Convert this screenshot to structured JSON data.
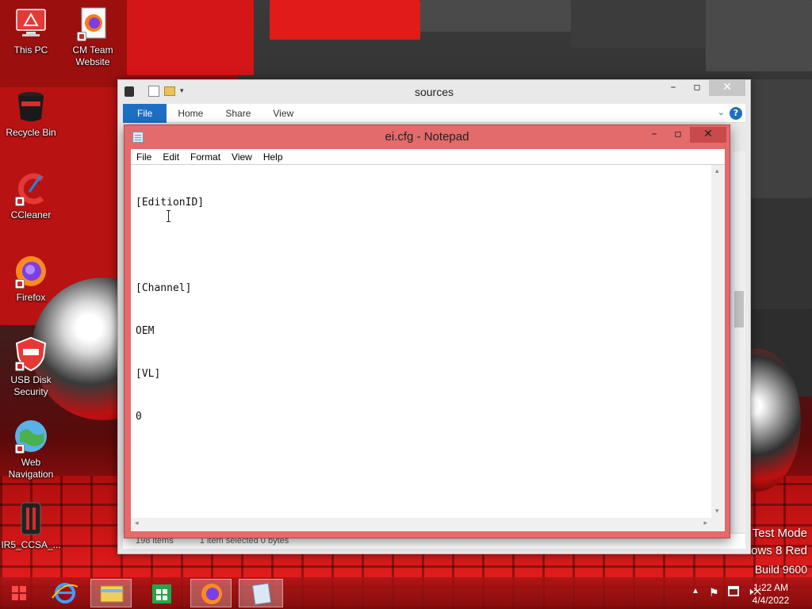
{
  "desktop": {
    "icons": [
      {
        "label": "This PC",
        "icon": "this-pc-icon"
      },
      {
        "label": "CM Team\nWebsite",
        "icon": "firefox-shortcut-icon"
      },
      {
        "label": "Recycle Bin",
        "icon": "recycle-bin-icon"
      },
      {
        "label": "CCleaner",
        "icon": "ccleaner-icon"
      },
      {
        "label": "Firefox",
        "icon": "firefox-icon"
      },
      {
        "label": "USB Disk\nSecurity",
        "icon": "usb-disk-security-icon"
      },
      {
        "label": "Web\nNavigation",
        "icon": "web-navigation-icon"
      },
      {
        "label": "IR5_CCSA_...",
        "icon": "ir5-ccsa-icon"
      }
    ],
    "watermark": {
      "line1": "Test Mode",
      "line2": "lows 8 Red",
      "line3": "Build 9600"
    }
  },
  "explorer": {
    "title": "sources",
    "ribbon_tabs": [
      "File",
      "Home",
      "Share",
      "View"
    ],
    "status": {
      "items": "198 items",
      "selected": "1 item selected  0 bytes"
    },
    "help_glyph": "?"
  },
  "notepad": {
    "title": "ei.cfg - Notepad",
    "menus": [
      "File",
      "Edit",
      "Format",
      "View",
      "Help"
    ],
    "lines": [
      "[EditionID]",
      "",
      "[Channel]",
      "OEM",
      "[VL]",
      "0"
    ]
  },
  "taskbar": {
    "apps": [
      "internet-explorer-icon",
      "file-explorer-icon",
      "store-icon",
      "firefox-icon",
      "notepad-icon"
    ],
    "clock": {
      "time": "1:22 AM",
      "date": "4/4/2022"
    }
  },
  "colors": {
    "accent": "#1e6fc4",
    "notepad_frame": "#e36b6b",
    "taskbar": "#a81414"
  }
}
